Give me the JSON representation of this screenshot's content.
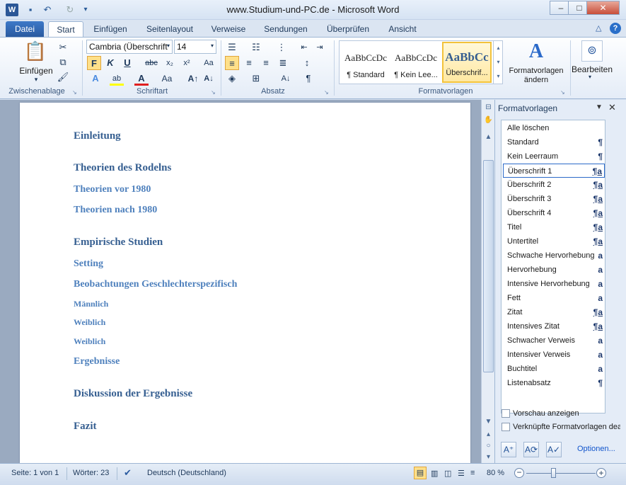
{
  "window": {
    "title": "www.Studium-und-PC.de - Microsoft Word",
    "controls": {
      "minimize": "–",
      "maximize": "□",
      "close": "✕"
    }
  },
  "qat": {
    "icons": [
      "word-icon",
      "save-icon",
      "undo-icon",
      "redo-icon"
    ]
  },
  "tabs": [
    {
      "label": "Datei"
    },
    {
      "label": "Start"
    },
    {
      "label": "Einfügen"
    },
    {
      "label": "Seitenlayout"
    },
    {
      "label": "Verweise"
    },
    {
      "label": "Sendungen"
    },
    {
      "label": "Überprüfen"
    },
    {
      "label": "Ansicht"
    }
  ],
  "ribbon": {
    "clipboard": {
      "label": "Zwischenablage",
      "paste": "Einfügen"
    },
    "font": {
      "label": "Schriftart",
      "family": "Cambria (Überschrift",
      "size": "14"
    },
    "paragraph": {
      "label": "Absatz"
    },
    "styles": {
      "label": "Formatvorlagen",
      "items": [
        {
          "preview": "AaBbCcDc",
          "name": "¶ Standard"
        },
        {
          "preview": "AaBbCcDc",
          "name": "¶ Kein Lee..."
        },
        {
          "preview": "AaBbCc",
          "name": "Überschrif..."
        }
      ],
      "change": "Formatvorlagen ändern"
    },
    "edit": {
      "label": "Bearbeiten"
    }
  },
  "document": {
    "headings": [
      {
        "text": "Einleitung",
        "level": 1
      },
      {
        "text": "Theorien des Rodelns",
        "level": 1
      },
      {
        "text": "Theorien vor 1980",
        "level": 2
      },
      {
        "text": "Theorien nach 1980",
        "level": 2
      },
      {
        "text": "Empirische Studien",
        "level": 1
      },
      {
        "text": "Setting",
        "level": 2
      },
      {
        "text": "Beobachtungen Geschlechterspezifisch",
        "level": 2
      },
      {
        "text": "Männlich",
        "level": 3
      },
      {
        "text": "Weiblich",
        "level": 3
      },
      {
        "text": "Weiblich",
        "level": 3
      },
      {
        "text": "Ergebnisse",
        "level": 2
      },
      {
        "text": "Diskussion der Ergebnisse",
        "level": 1
      },
      {
        "text": "Fazit",
        "level": 1
      }
    ]
  },
  "pane": {
    "title": "Formatvorlagen",
    "styles": [
      {
        "name": "Alle löschen",
        "mark": ""
      },
      {
        "name": "Standard",
        "mark": "¶"
      },
      {
        "name": "Kein Leerraum",
        "mark": "¶"
      },
      {
        "name": "Überschrift 1",
        "mark": "¶a"
      },
      {
        "name": "Überschrift 2",
        "mark": "¶a"
      },
      {
        "name": "Überschrift 3",
        "mark": "¶a"
      },
      {
        "name": "Überschrift 4",
        "mark": "¶a"
      },
      {
        "name": "Titel",
        "mark": "¶a"
      },
      {
        "name": "Untertitel",
        "mark": "¶a"
      },
      {
        "name": "Schwache Hervorhebung",
        "mark": "a"
      },
      {
        "name": "Hervorhebung",
        "mark": "a"
      },
      {
        "name": "Intensive Hervorhebung",
        "mark": "a"
      },
      {
        "name": "Fett",
        "mark": "a"
      },
      {
        "name": "Zitat",
        "mark": "¶a"
      },
      {
        "name": "Intensives Zitat",
        "mark": "¶a"
      },
      {
        "name": "Schwacher Verweis",
        "mark": "a"
      },
      {
        "name": "Intensiver Verweis",
        "mark": "a"
      },
      {
        "name": "Buchtitel",
        "mark": "a"
      },
      {
        "name": "Listenabsatz",
        "mark": "¶"
      }
    ],
    "selected_style": "Überschrift 1",
    "preview_label": "Vorschau anzeigen",
    "linked_label": "Verknüpfte Formatvorlagen dea",
    "options_link": "Optionen..."
  },
  "status": {
    "page": "Seite: 1 von 1",
    "words": "Wörter: 23",
    "language": "Deutsch (Deutschland)",
    "zoom": "80 %"
  },
  "colors": {
    "heading1": "#365f91",
    "heading2": "#4f81bd",
    "accent": "#2a5aa0"
  }
}
